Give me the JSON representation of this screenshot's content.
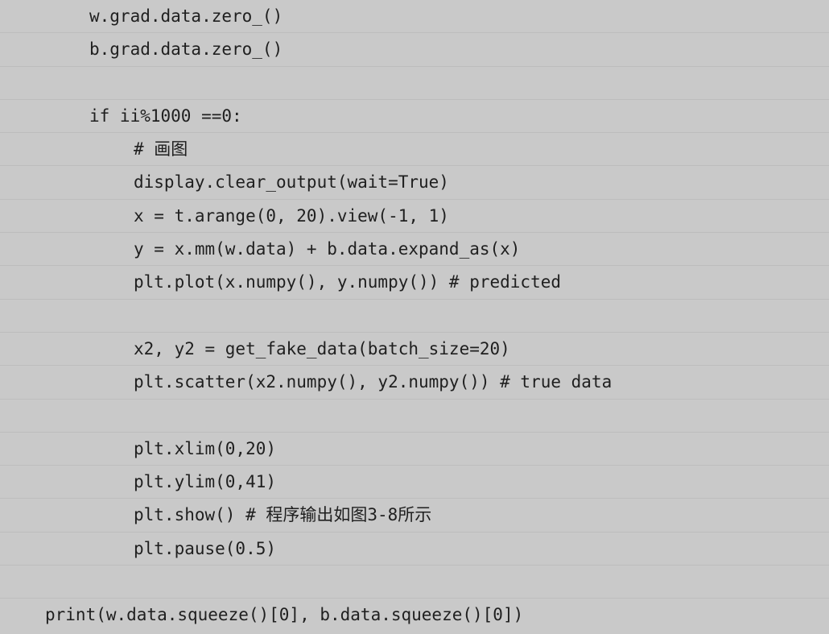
{
  "code": {
    "lines": [
      {
        "indent": 1,
        "text": "w.grad.data.zero_()"
      },
      {
        "indent": 1,
        "text": "b.grad.data.zero_()"
      },
      {
        "indent": 1,
        "text": ""
      },
      {
        "indent": 1,
        "text": "if ii%1000 ==0:"
      },
      {
        "indent": 2,
        "text": "# 画图"
      },
      {
        "indent": 2,
        "text": "display.clear_output(wait=True)"
      },
      {
        "indent": 2,
        "text": "x = t.arange(0, 20).view(-1, 1)"
      },
      {
        "indent": 2,
        "text": "y = x.mm(w.data) + b.data.expand_as(x)"
      },
      {
        "indent": 2,
        "text": "plt.plot(x.numpy(), y.numpy()) # predicted"
      },
      {
        "indent": 2,
        "text": ""
      },
      {
        "indent": 2,
        "text": "x2, y2 = get_fake_data(batch_size=20)"
      },
      {
        "indent": 2,
        "text": "plt.scatter(x2.numpy(), y2.numpy()) # true data"
      },
      {
        "indent": 2,
        "text": ""
      },
      {
        "indent": 2,
        "text": "plt.xlim(0,20)"
      },
      {
        "indent": 2,
        "text": "plt.ylim(0,41)"
      },
      {
        "indent": 2,
        "text": "plt.show() # 程序输出如图3-8所示"
      },
      {
        "indent": 2,
        "text": "plt.pause(0.5)"
      },
      {
        "indent": 0,
        "text": ""
      },
      {
        "indent": 0,
        "text": "print(w.data.squeeze()[0], b.data.squeeze()[0])"
      }
    ]
  }
}
